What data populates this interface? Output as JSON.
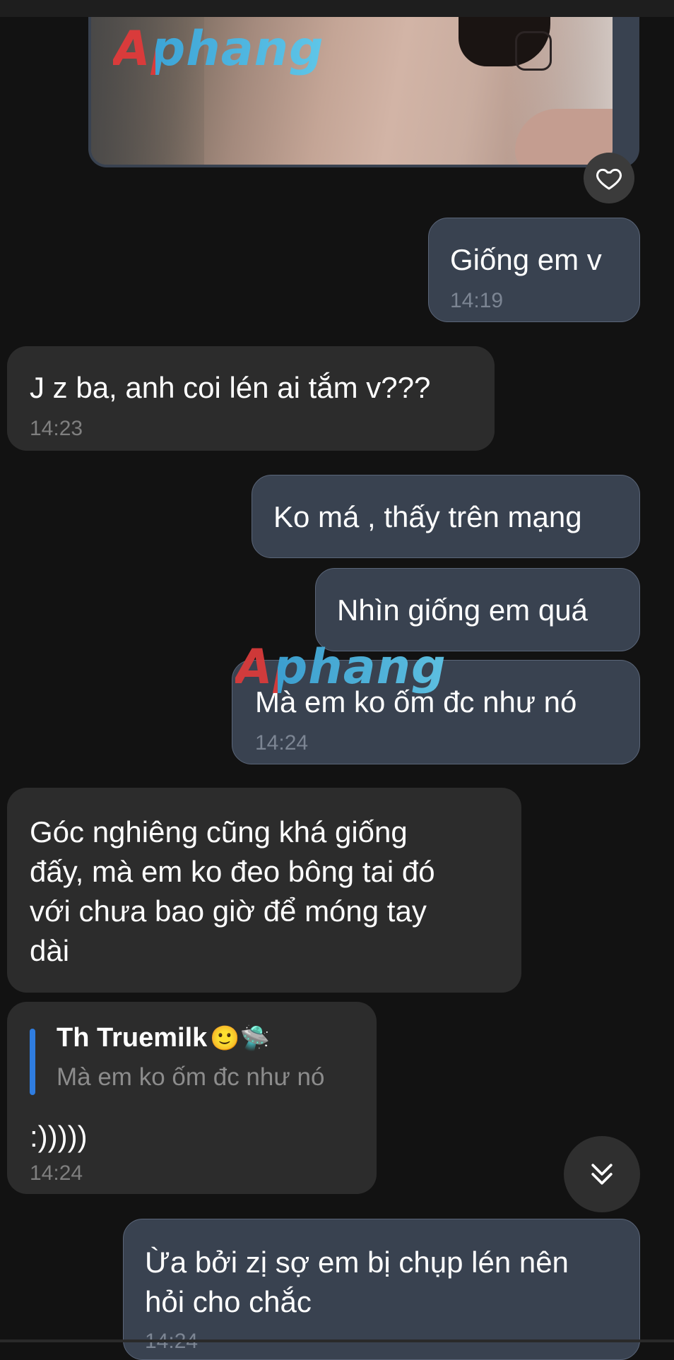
{
  "watermark": {
    "text": "Aphang",
    "colors": [
      "#d93b3b",
      "#3da4d6"
    ]
  },
  "theme": {
    "background": "#121212",
    "outgoing_bubble": "#394250",
    "incoming_bubble": "#2c2c2c",
    "accent": "#2f7de1"
  },
  "messages": [
    {
      "direction": "out",
      "text": "Giống em v",
      "time": "14:19"
    },
    {
      "direction": "in",
      "text": "J z ba, anh coi lén ai tắm v???",
      "time": "14:23"
    },
    {
      "direction": "out",
      "text": "Ko má , thấy trên mạng",
      "time": ""
    },
    {
      "direction": "out",
      "text": "Nhìn giống em quá",
      "time": ""
    },
    {
      "direction": "out",
      "text": "Mà em ko ốm đc như nó",
      "time": "14:24"
    },
    {
      "direction": "in",
      "lines": [
        "Góc nghiêng cũng khá giống",
        "đấy, mà em ko đeo bông tai đó",
        "với chưa bao giờ để móng tay",
        "dài"
      ],
      "time": ""
    },
    {
      "direction": "in",
      "reply": {
        "name": "Th Truemilk",
        "name_emoji": "🙂🛸",
        "quote": "Mà em ko ốm đc như nó"
      },
      "text": ":)))))",
      "time": "14:24"
    },
    {
      "direction": "out",
      "lines": [
        "Ừa bởi zị sợ em bị chụp lén nên",
        "hỏi cho chắc"
      ],
      "time": "14:24"
    }
  ],
  "icons": {
    "reaction": "heart-outline-icon",
    "scroll": "double-chevron-down-icon"
  }
}
